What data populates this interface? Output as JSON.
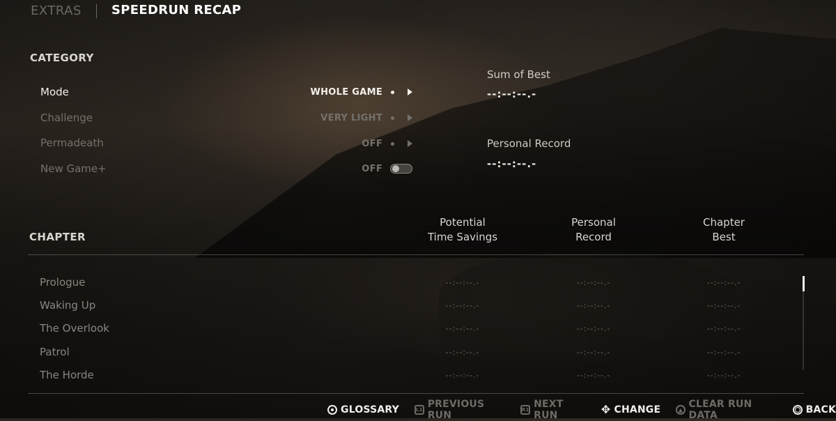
{
  "header": {
    "tab_inactive": "EXTRAS",
    "tab_active": "SPEEDRUN RECAP"
  },
  "category": {
    "title": "CATEGORY",
    "options": [
      {
        "label": "Mode",
        "value": "WHOLE GAME",
        "control": "arrow",
        "active": true
      },
      {
        "label": "Challenge",
        "value": "VERY LIGHT",
        "control": "arrow",
        "active": false
      },
      {
        "label": "Permadeath",
        "value": "OFF",
        "control": "arrow",
        "active": false
      },
      {
        "label": "New Game+",
        "value": "OFF",
        "control": "toggle",
        "active": false
      }
    ]
  },
  "stats": {
    "sum_of_best_label": "Sum of Best",
    "sum_of_best_value": "--:--:--.-",
    "personal_record_label": "Personal Record",
    "personal_record_value": "--:--:--.-"
  },
  "chapters": {
    "title": "CHAPTER",
    "col_potential_1": "Potential",
    "col_potential_2": "Time Savings",
    "col_personal_1": "Personal",
    "col_personal_2": "Record",
    "col_best_1": "Chapter",
    "col_best_2": "Best",
    "rows": [
      {
        "name": "Prologue",
        "potential": "--:--:--.-",
        "personal": "--:--:--.-",
        "best": "--:--:--.-"
      },
      {
        "name": "Waking Up",
        "potential": "--:--:--.-",
        "personal": "--:--:--.-",
        "best": "--:--:--.-"
      },
      {
        "name": "The Overlook",
        "potential": "--:--:--.-",
        "personal": "--:--:--.-",
        "best": "--:--:--.-"
      },
      {
        "name": "Patrol",
        "potential": "--:--:--.-",
        "personal": "--:--:--.-",
        "best": "--:--:--.-"
      },
      {
        "name": "The Horde",
        "potential": "--:--:--.-",
        "personal": "--:--:--.-",
        "best": "--:--:--.-"
      }
    ]
  },
  "footer": {
    "glossary": "GLOSSARY",
    "previous_run": "PREVIOUS RUN",
    "previous_run_icon": "L1",
    "next_run": "NEXT RUN",
    "next_run_icon": "R1",
    "change": "CHANGE",
    "clear_run_data": "CLEAR RUN DATA",
    "back": "BACK"
  },
  "colors": {
    "active_text": "#ffffff",
    "inactive_text": "#6e6a64",
    "accent_white": "#f2efea"
  }
}
